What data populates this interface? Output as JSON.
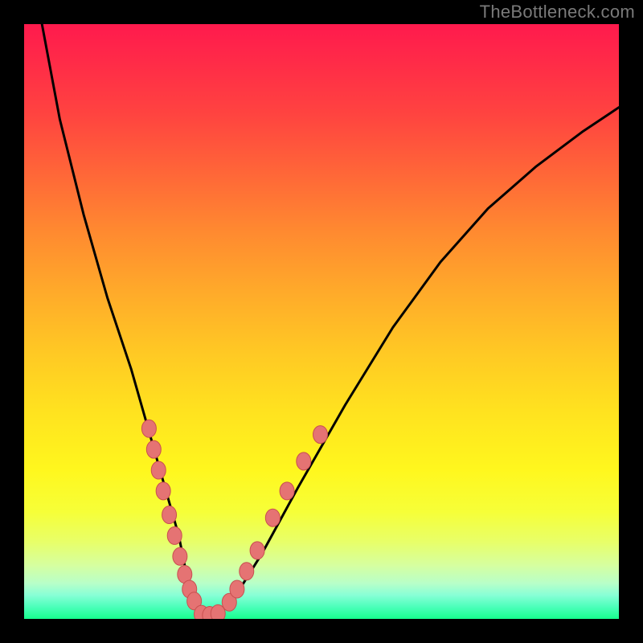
{
  "watermark": "TheBottleneck.com",
  "chart_data": {
    "type": "line",
    "title": "",
    "xlabel": "",
    "ylabel": "",
    "xlim": [
      0,
      100
    ],
    "ylim": [
      0,
      100
    ],
    "series": [
      {
        "name": "curve",
        "x": [
          3,
          6,
          10,
          14,
          18,
          22,
          24,
          26,
          27,
          28,
          29,
          30,
          32,
          35,
          40,
          46,
          54,
          62,
          70,
          78,
          86,
          94,
          100
        ],
        "y": [
          100,
          84,
          68,
          54,
          42,
          28,
          21,
          14,
          9,
          5,
          2,
          0.6,
          0.6,
          3,
          11,
          22,
          36,
          49,
          60,
          69,
          76,
          82,
          86
        ]
      }
    ],
    "markers": {
      "left_branch": [
        {
          "x": 21.0,
          "y": 32.0
        },
        {
          "x": 21.8,
          "y": 28.5
        },
        {
          "x": 22.6,
          "y": 25.0
        },
        {
          "x": 23.4,
          "y": 21.5
        },
        {
          "x": 24.4,
          "y": 17.5
        },
        {
          "x": 25.3,
          "y": 14.0
        },
        {
          "x": 26.2,
          "y": 10.5
        },
        {
          "x": 27.0,
          "y": 7.5
        },
        {
          "x": 27.8,
          "y": 5.0
        },
        {
          "x": 28.6,
          "y": 3.0
        }
      ],
      "bottom": [
        {
          "x": 29.8,
          "y": 0.8
        },
        {
          "x": 31.2,
          "y": 0.6
        },
        {
          "x": 32.6,
          "y": 0.9
        }
      ],
      "right_branch": [
        {
          "x": 34.5,
          "y": 2.8
        },
        {
          "x": 35.8,
          "y": 5.0
        },
        {
          "x": 37.4,
          "y": 8.0
        },
        {
          "x": 39.2,
          "y": 11.5
        },
        {
          "x": 41.8,
          "y": 17.0
        },
        {
          "x": 44.2,
          "y": 21.5
        },
        {
          "x": 47.0,
          "y": 26.5
        },
        {
          "x": 49.8,
          "y": 31.0
        }
      ]
    },
    "colors": {
      "curve": "#000000",
      "marker_fill": "#e57373",
      "marker_stroke": "#c94f4f"
    }
  }
}
